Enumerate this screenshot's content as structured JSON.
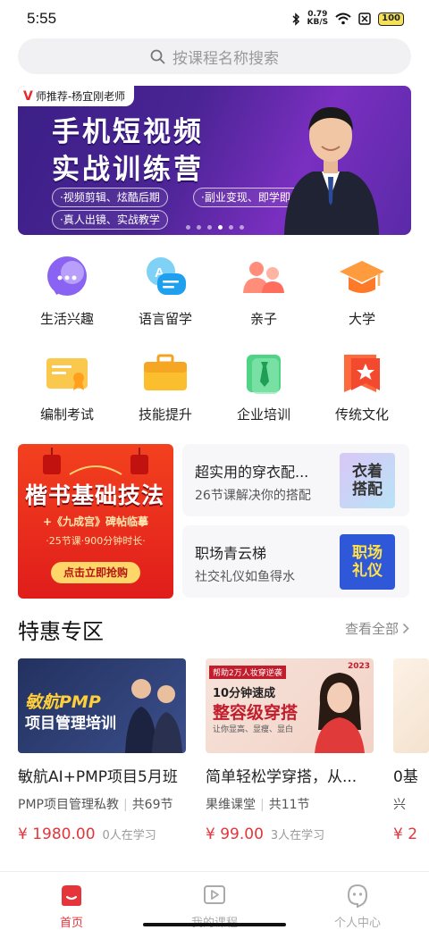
{
  "status": {
    "time": "5:55",
    "net_speed_value": "0.79",
    "net_speed_unit": "KB/S",
    "battery": "100"
  },
  "search": {
    "placeholder": "按课程名称搜索"
  },
  "banner": {
    "tag": "师推荐-杨宜刚老师",
    "title_line1": "手机短视频",
    "title_line2": "实战训练营",
    "pills": [
      "·视频剪辑、炫酷后期",
      "·副业变现、即学即练",
      "·真人出镜、实战教学"
    ],
    "dots": 6,
    "active_dot": 3
  },
  "categories": [
    {
      "label": "生活兴趣",
      "icon": "chat-bubble-icon"
    },
    {
      "label": "语言留学",
      "icon": "speech-bubble-icon"
    },
    {
      "label": "亲子",
      "icon": "parent-child-icon"
    },
    {
      "label": "大学",
      "icon": "graduation-cap-icon"
    },
    {
      "label": "编制考试",
      "icon": "certificate-icon"
    },
    {
      "label": "技能提升",
      "icon": "briefcase-icon"
    },
    {
      "label": "企业培训",
      "icon": "tie-icon"
    },
    {
      "label": "传统文化",
      "icon": "star-bookmark-icon"
    }
  ],
  "promo": {
    "left": {
      "title": "楷书基础技法",
      "sub": "+《九成宫》碑帖临摹",
      "sub2": "·25节课·900分钟时长·",
      "button": "点击立即抢购"
    },
    "cards": [
      {
        "title": "超实用的穿衣配...",
        "sub": "26节课解决你的搭配",
        "thumb_text": "衣着搭配"
      },
      {
        "title": "职场青云梯",
        "sub": "社交礼仪如鱼得水",
        "thumb_text": "职场礼仪"
      }
    ]
  },
  "section": {
    "title": "特惠专区",
    "view_all": "查看全部"
  },
  "courses": [
    {
      "title": "敏航AI+PMP项目5月班",
      "provider": "PMP项目管理私教",
      "lessons": "共69节",
      "price": "¥ 1980.00",
      "learners": "0人在学习",
      "thumb_line1": "敏航PMP",
      "thumb_line2": "项目管理培训"
    },
    {
      "title": "简单轻松学穿搭，从...",
      "provider": "果维课堂",
      "lessons": "共11节",
      "price": "¥ 99.00",
      "learners": "3人在学习",
      "thumb_badge": "帮助2万人妆穿逆袭",
      "thumb_line1": "10分钟速成",
      "thumb_line2": "整容级穿搭",
      "thumb_line3": "让你显高、显瘦、显白",
      "thumb_year": "2023"
    },
    {
      "title": "0基",
      "provider": "兴",
      "price": "¥ 2"
    }
  ],
  "nav": [
    {
      "label": "首页",
      "icon": "home-icon",
      "active": true
    },
    {
      "label": "我的课程",
      "icon": "play-icon",
      "active": false
    },
    {
      "label": "个人中心",
      "icon": "profile-icon",
      "active": false
    }
  ],
  "colors": {
    "accent": "#e5343a",
    "banner_bg": "#4a2494",
    "promo_red": "#e01d1b"
  }
}
